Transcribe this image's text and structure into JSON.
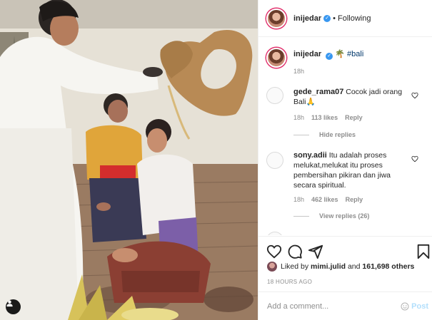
{
  "post": {
    "author": "inijedar",
    "follow_status": "Following",
    "separator": "•",
    "caption_hashtag": "#bali",
    "caption_emoji": "🌴",
    "caption_time": "18h"
  },
  "comments": [
    {
      "username": "gede_rama07",
      "text": "Cocok jadi orang Bali🙏",
      "time": "18h",
      "likes": "113 likes",
      "reply_label": "Reply",
      "replies_label": "Hide replies"
    },
    {
      "username": "sony.adii",
      "text": "Itu adalah proses melukat,melukat itu proses pembersihan pikiran dan jiwa secara spiritual.",
      "time": "18h",
      "likes": "462 likes",
      "reply_label": "Reply",
      "replies_label": "View replies (26)"
    }
  ],
  "engagement": {
    "liked_by_prefix": "Liked by",
    "liked_by_user": "mimi.julid",
    "liked_by_and": "and",
    "liked_by_count": "161,698 others",
    "timestamp": "18 HOURS AGO"
  },
  "comment_box": {
    "placeholder": "Add a comment...",
    "post_label": "Post"
  },
  "icons": [
    "user-tag-icon",
    "verified-icon",
    "heart-icon",
    "comment-icon",
    "share-icon",
    "bookmark-icon",
    "emoji-icon"
  ],
  "colors": {
    "verified_blue": "#3897f0",
    "post_button_disabled": "#b2dffc",
    "hashtag": "#00376b",
    "muted_text": "#8e8e8e"
  }
}
